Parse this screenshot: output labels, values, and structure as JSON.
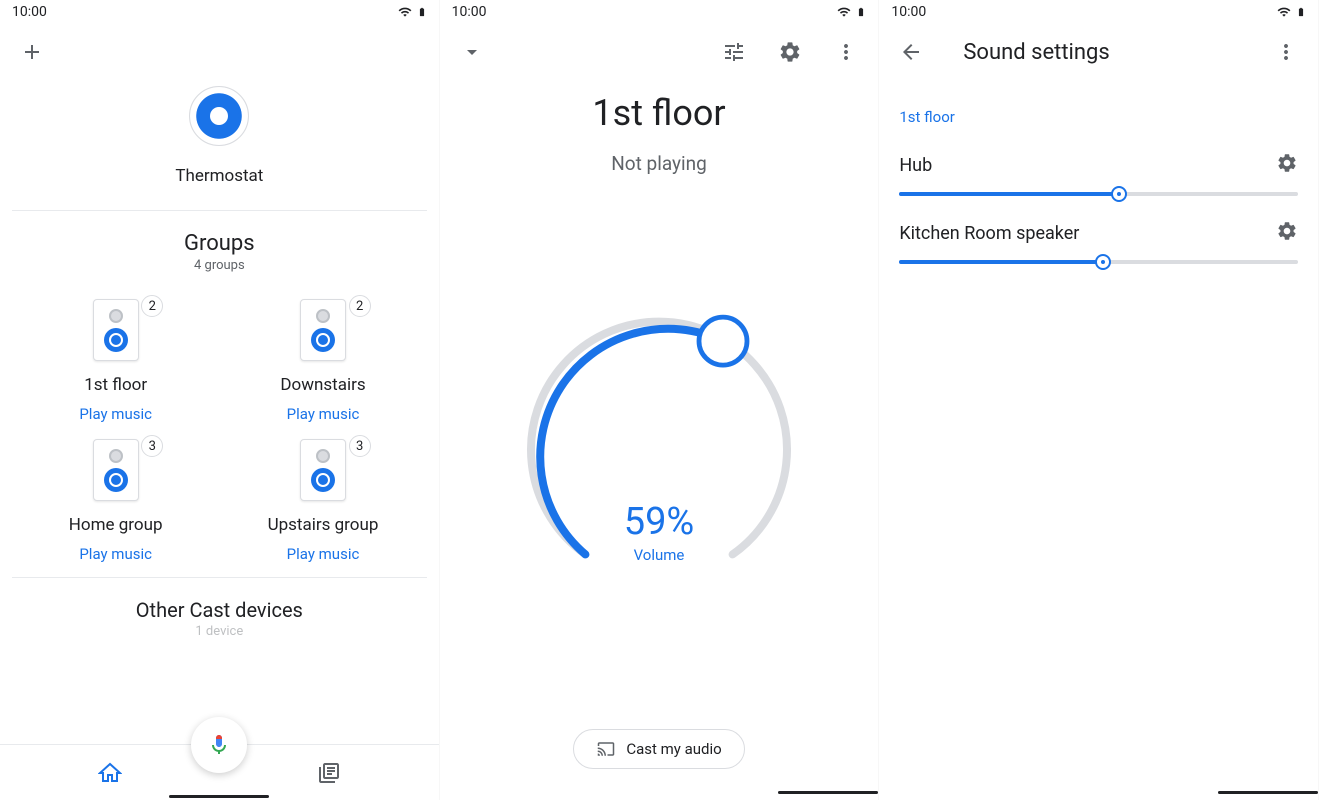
{
  "statusbar": {
    "time": "10:00"
  },
  "screen1": {
    "thermostat_label": "Thermostat",
    "groups_title": "Groups",
    "groups_sub": "4 groups",
    "groups": [
      {
        "name": "1st floor",
        "count": "2",
        "action": "Play music"
      },
      {
        "name": "Downstairs",
        "count": "2",
        "action": "Play music"
      },
      {
        "name": "Home group",
        "count": "3",
        "action": "Play music"
      },
      {
        "name": "Upstairs group",
        "count": "3",
        "action": "Play music"
      }
    ],
    "other_title": "Other Cast devices",
    "other_sub": "1 device"
  },
  "screen2": {
    "title": "1st floor",
    "status": "Not playing",
    "volume_value": "59%",
    "volume_label": "Volume",
    "cast_label": "Cast my audio"
  },
  "screen3": {
    "title": "Sound settings",
    "group_label": "1st floor",
    "sliders": [
      {
        "name": "Hub",
        "percent": 55
      },
      {
        "name": "Kitchen Room speaker",
        "percent": 51
      }
    ]
  }
}
